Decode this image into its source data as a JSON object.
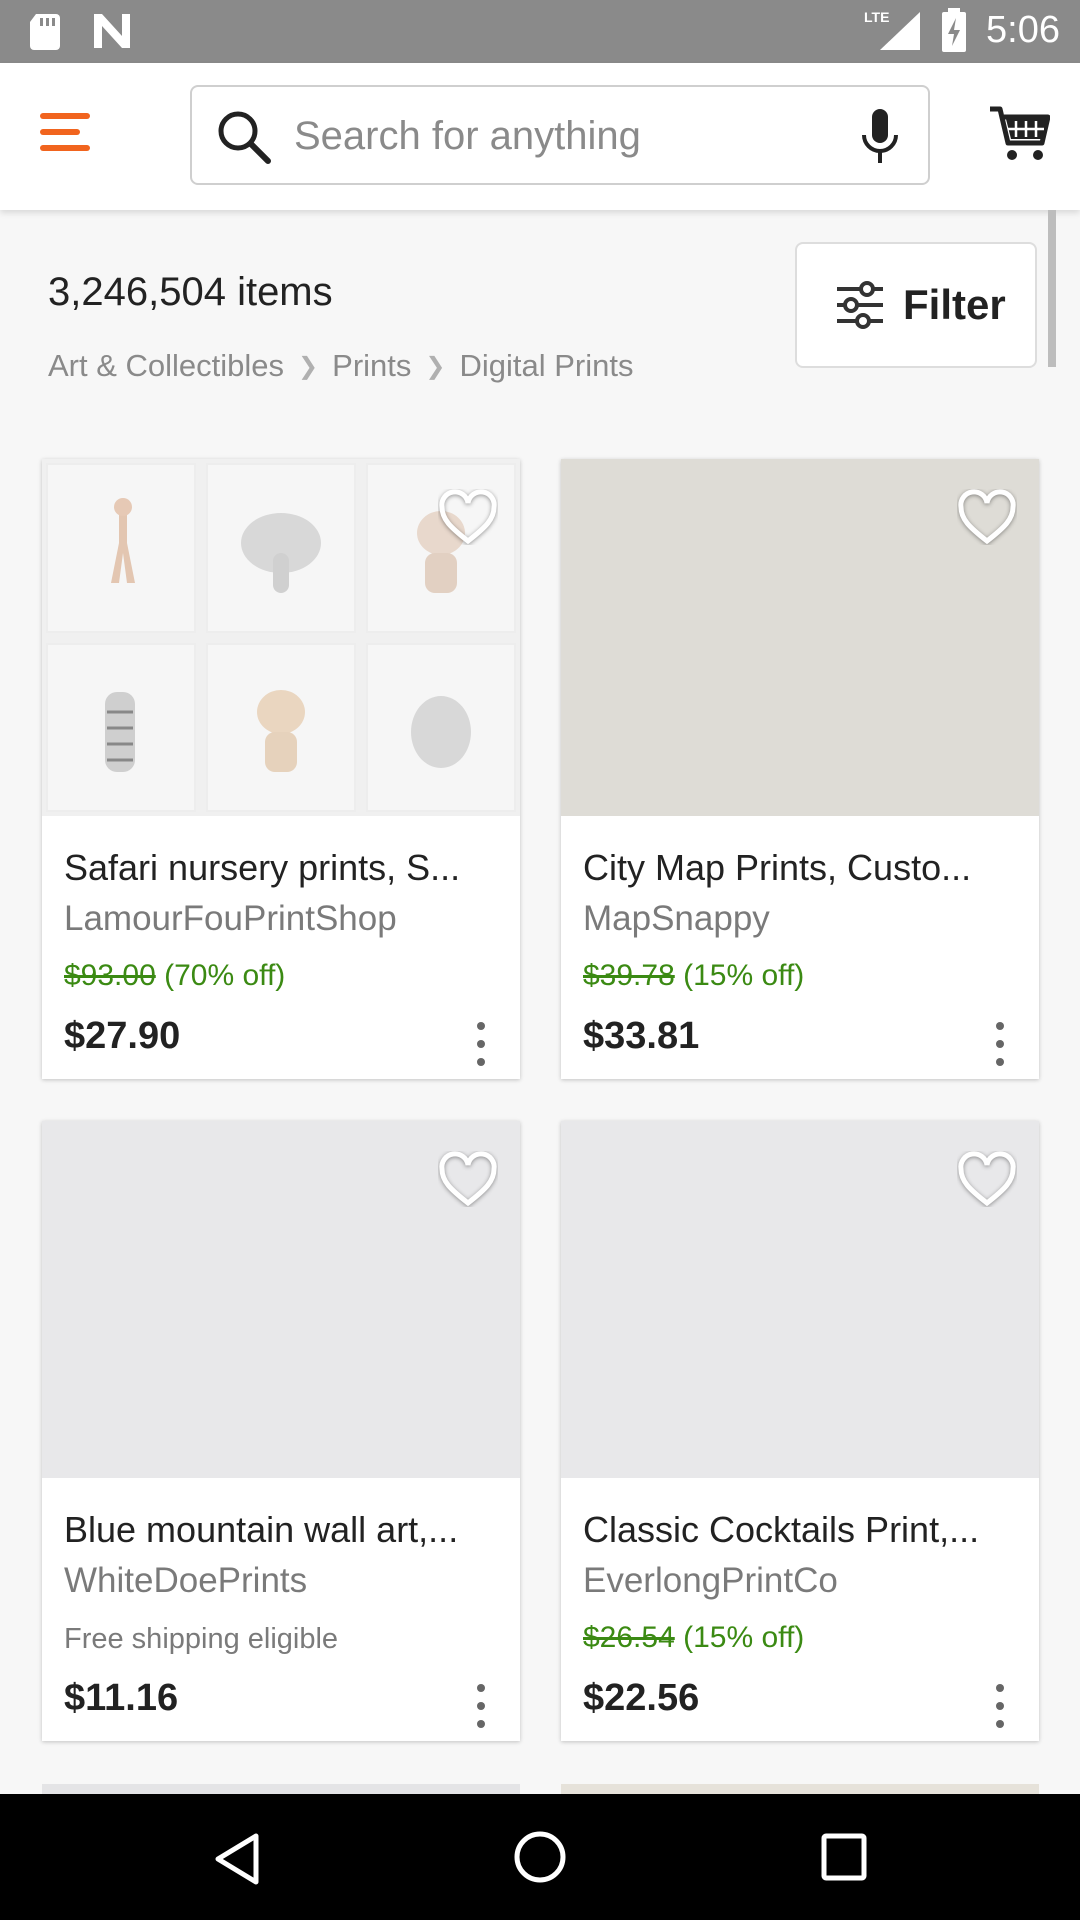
{
  "status_bar": {
    "time": "5:06",
    "network": "LTE",
    "left_icons": [
      "sd-card-icon",
      "n-notification-icon"
    ],
    "right_icons": [
      "lte-signal-icon",
      "battery-charging-icon"
    ]
  },
  "search": {
    "placeholder": "Search for anything"
  },
  "results": {
    "count": "3,246,504 items",
    "breadcrumb": [
      "Art & Collectibles",
      "Prints",
      "Digital Prints"
    ],
    "filter_label": "Filter"
  },
  "listings": [
    {
      "title": "Safari nursery prints, S...",
      "shop": "LamourFouPrintShop",
      "original_price": "$93.00",
      "discount": "(70% off)",
      "price": "$27.90",
      "image_color": "#f2f2f2"
    },
    {
      "title": "City Map Prints, Custo...",
      "shop": "MapSnappy",
      "original_price": "$39.78",
      "discount": "(15% off)",
      "price": "$33.81",
      "image_color": "#dedcd6"
    },
    {
      "title": "Blue mountain wall art,...",
      "shop": "WhiteDoePrints",
      "shipping": "Free shipping eligible",
      "price": "$11.16",
      "image_color": "#e8e8ea"
    },
    {
      "title": "Classic Cocktails Print,...",
      "shop": "EverlongPrintCo",
      "original_price": "$26.54",
      "discount": "(15% off)",
      "price": "$22.56",
      "image_color": "#e8e8ea"
    }
  ],
  "colors": {
    "accent": "#f1641e",
    "discount_green": "#3b8a13",
    "status_bar": "#8a8a8a"
  }
}
